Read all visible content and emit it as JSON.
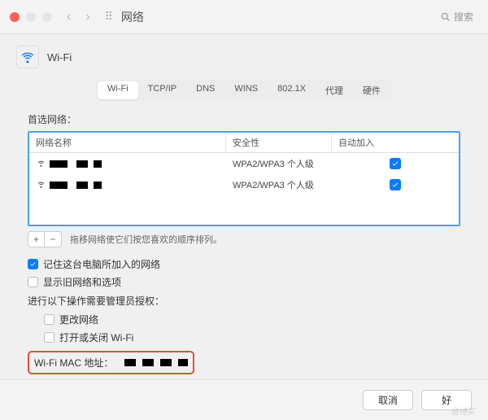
{
  "titlebar": {
    "title": "网络",
    "search_placeholder": "搜索"
  },
  "header": {
    "title": "Wi-Fi"
  },
  "tabs": [
    "Wi-Fi",
    "TCP/IP",
    "DNS",
    "WINS",
    "802.1X",
    "代理",
    "硬件"
  ],
  "active_tab_index": 0,
  "section_label": "首选网络：",
  "table": {
    "columns": {
      "name": "网络名称",
      "security": "安全性",
      "auto": "自动加入"
    },
    "rows": [
      {
        "name_redacted": true,
        "security": "WPA2/WPA3 个人级",
        "auto_join": true
      },
      {
        "name_redacted": true,
        "security": "WPA2/WPA3 个人级",
        "auto_join": true
      }
    ]
  },
  "controls": {
    "add": "+",
    "remove": "−",
    "hint": "拖移网络使它们按您喜欢的顺序排列。"
  },
  "options": {
    "remember": {
      "label": "记住这台电脑所加入的网络",
      "checked": true
    },
    "legacy": {
      "label": "显示旧网络和选项",
      "checked": false
    },
    "admin_label": "进行以下操作需要管理员授权：",
    "change": {
      "label": "更改网络",
      "checked": false
    },
    "toggle": {
      "label": "打开或关闭 Wi-Fi",
      "checked": false
    }
  },
  "mac": {
    "label": "Wi-Fi MAC 地址：",
    "redacted_blocks": 4
  },
  "footer": {
    "cancel": "取消",
    "ok": "好"
  },
  "watermark": "值得买"
}
